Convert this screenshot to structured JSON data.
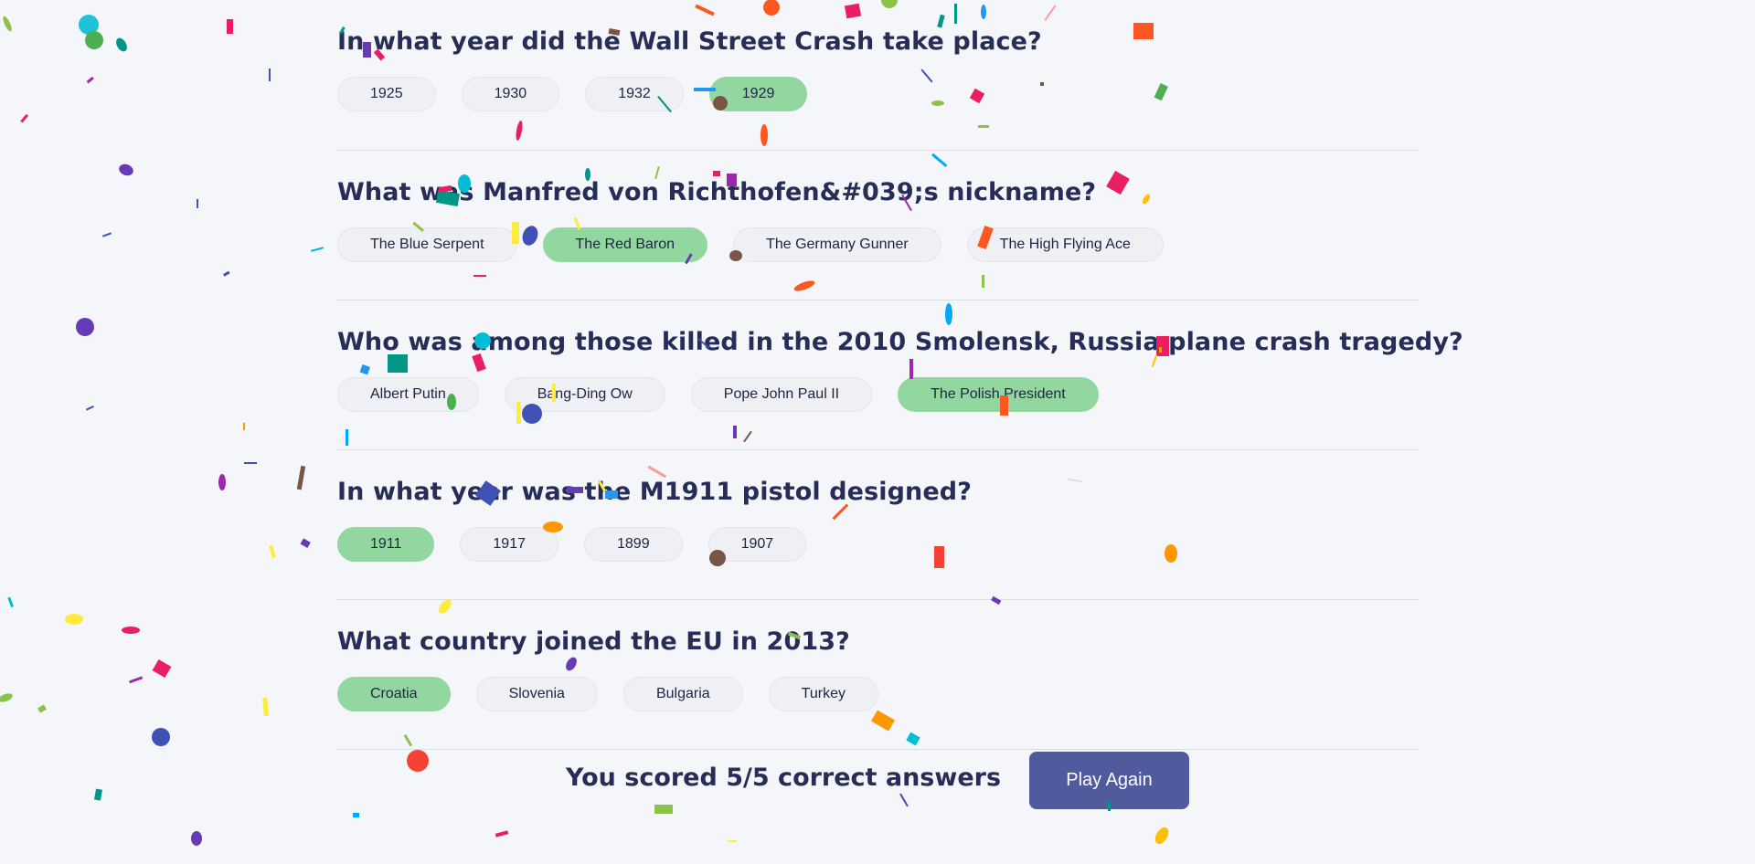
{
  "questions": [
    {
      "text": "In what year did the Wall Street Crash take place?",
      "answers": [
        "1925",
        "1930",
        "1932",
        "1929"
      ],
      "selected_index": 3
    },
    {
      "text": "What was Manfred von Richthofen&#039;s nickname?",
      "answers": [
        "The Blue Serpent",
        "The Red Baron",
        "The Germany Gunner",
        "The High Flying Ace"
      ],
      "selected_index": 1
    },
    {
      "text": "Who was among those killed in the 2010 Smolensk, Russia plane crash tragedy?",
      "answers": [
        "Albert Putin",
        "Bang-Ding Ow",
        "Pope John Paul II",
        "The Polish President"
      ],
      "selected_index": 3
    },
    {
      "text": "In what year was the M1911 pistol designed?",
      "answers": [
        "1911",
        "1917",
        "1899",
        "1907"
      ],
      "selected_index": 0
    },
    {
      "text": "What country joined the EU in 2013?",
      "answers": [
        "Croatia",
        "Slovenia",
        "Bulgaria",
        "Turkey"
      ],
      "selected_index": 0
    }
  ],
  "result": {
    "score_text": "You scored 5/5 correct answers",
    "play_again_label": "Play Again"
  },
  "colors": {
    "selected_answer": "#93d7a0",
    "answer_bg": "#eef0f4",
    "heading": "#262d56",
    "button": "#505b9d",
    "background": "#f5f6fa"
  }
}
